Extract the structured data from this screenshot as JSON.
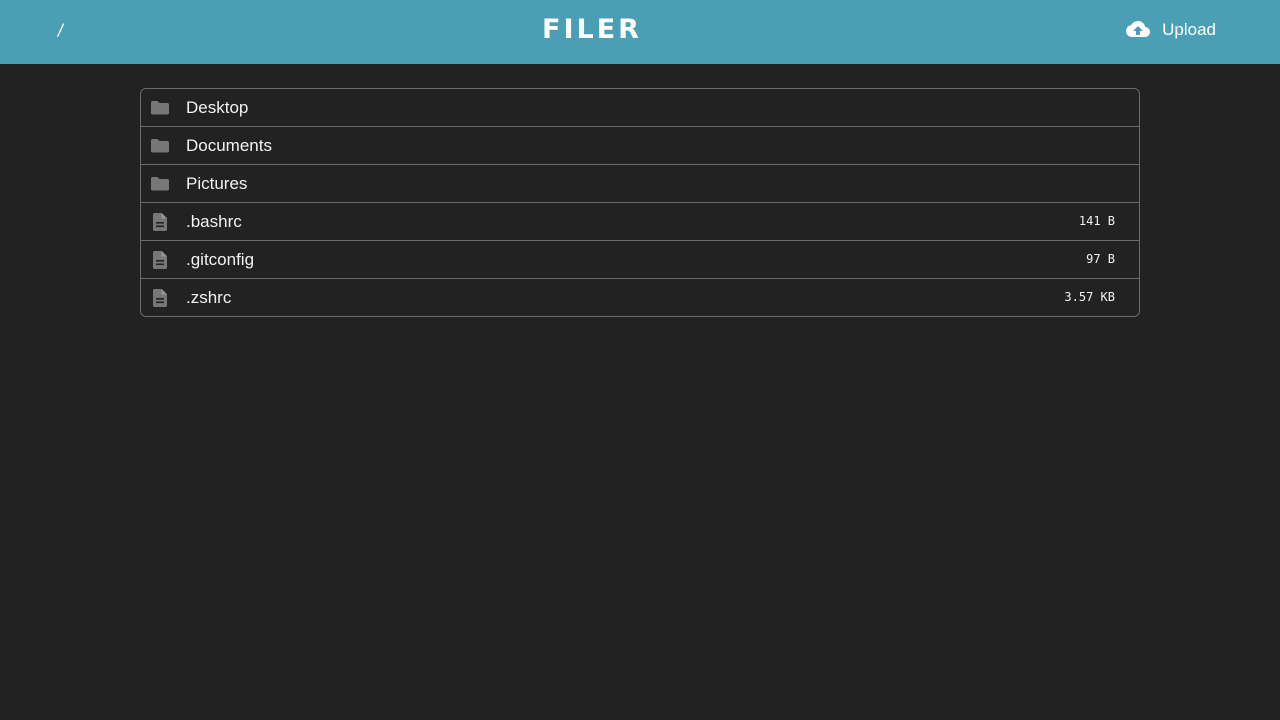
{
  "header": {
    "path": "/",
    "brand": "FILER",
    "upload_label": "Upload",
    "upload_icon": "cloud-upload-icon",
    "background_color": "#4a9fb5"
  },
  "colors": {
    "page_background": "#222222",
    "icon": "#777777",
    "border": "#6a6a6a"
  },
  "files": [
    {
      "name": "Desktop",
      "type": "folder",
      "icon": "folder-icon",
      "size": ""
    },
    {
      "name": "Documents",
      "type": "folder",
      "icon": "folder-icon",
      "size": ""
    },
    {
      "name": "Pictures",
      "type": "folder",
      "icon": "folder-icon",
      "size": ""
    },
    {
      "name": ".bashrc",
      "type": "file",
      "icon": "file-icon",
      "size": "141 B"
    },
    {
      "name": ".gitconfig",
      "type": "file",
      "icon": "file-icon",
      "size": "97 B"
    },
    {
      "name": ".zshrc",
      "type": "file",
      "icon": "file-icon",
      "size": "3.57 KB"
    }
  ]
}
